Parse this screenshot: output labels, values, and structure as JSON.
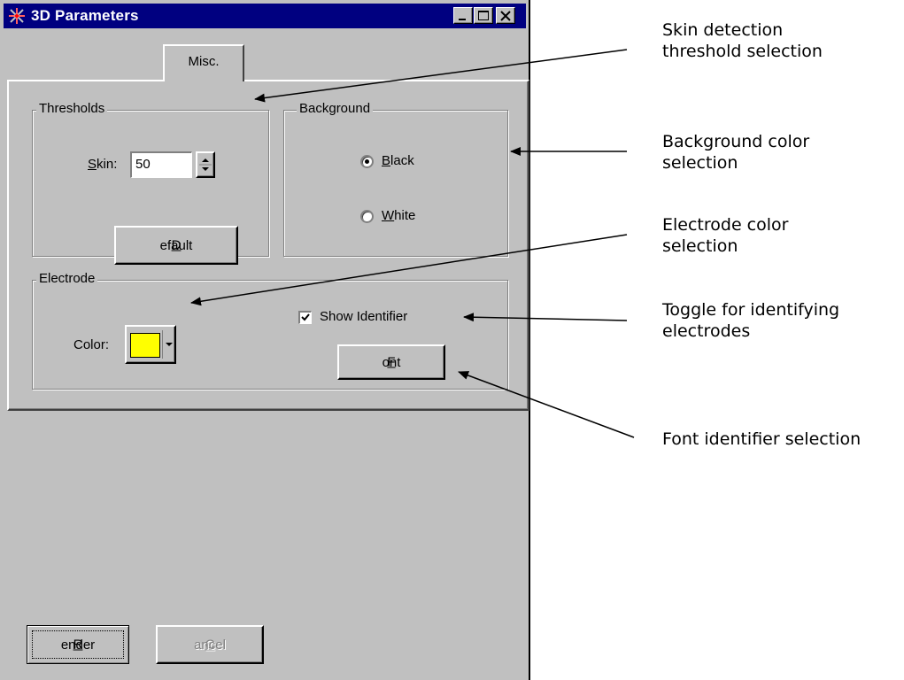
{
  "window": {
    "title": "3D Parameters"
  },
  "tabs": [
    {
      "label": "Misc."
    }
  ],
  "thresholds": {
    "group_label": "Thresholds",
    "skin_label": {
      "u": "S",
      "rest": "kin:"
    },
    "skin_value": "50",
    "default_button": {
      "u": "D",
      "rest": "efault"
    }
  },
  "background": {
    "group_label": "Background",
    "options": [
      {
        "u": "B",
        "rest": "lack",
        "selected": true
      },
      {
        "u": "W",
        "rest": "hite",
        "selected": false
      }
    ]
  },
  "electrode": {
    "group_label": "Electrode",
    "color_label": "Color:",
    "color_value": "#ffff00",
    "show_identifier_label": "Show Identifier",
    "show_identifier_checked": true,
    "font_button": {
      "u": "F",
      "rest": "ont"
    }
  },
  "footer": {
    "render_button": {
      "u": "R",
      "rest": "ender"
    },
    "cancel_button": {
      "u": "C",
      "rest": "ancel",
      "disabled": true
    }
  },
  "annotations": [
    {
      "line1": "Skin detection",
      "line2": "threshold selection"
    },
    {
      "line1": "Background color",
      "line2": "selection"
    },
    {
      "line1": "Electrode color",
      "line2": "selection"
    },
    {
      "line1": "Toggle for identifying",
      "line2": "electrodes"
    },
    {
      "line1": "Font identifier selection",
      "line2": ""
    }
  ],
  "colors": {
    "titlebar": "#000080",
    "face": "#c0c0c0",
    "electrode_swatch": "#ffff00"
  }
}
